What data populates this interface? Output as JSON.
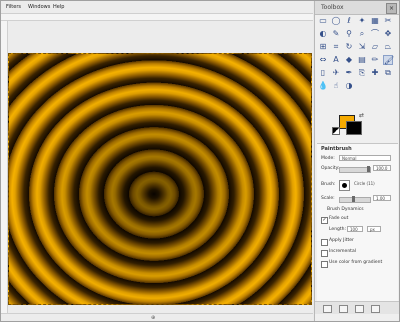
{
  "menubar": {
    "items": [
      "Filters",
      "Windows",
      "Help"
    ]
  },
  "toolbox": {
    "title": "Toolbox",
    "close_label": "×",
    "foreground_color": "#f5aa00",
    "background_color": "#000000",
    "options": {
      "title": "Paintbrush",
      "mode_label": "Mode:",
      "mode_value": "Normal",
      "opacity_label": "Opacity:",
      "opacity_value": "100.0",
      "brush_label": "Brush:",
      "brush_value": "Circle (11)",
      "scale_label": "Scale:",
      "scale_value": "1.00",
      "brush_dynamics_label": "Brush Dynamics",
      "fade_out_label": "Fade out",
      "length_label": "Length:",
      "length_value": "100",
      "length_unit": "px",
      "apply_jitter_label": "Apply Jitter",
      "incremental_label": "Incremental",
      "gradient_label": "Use color from gradient",
      "fade_out_checked": true,
      "apply_jitter_checked": false,
      "incremental_checked": false,
      "gradient_checked": false
    }
  },
  "image": {
    "description": "orange swirl ripple image"
  },
  "tools": [
    "rect-select",
    "ellipse-select",
    "free-select",
    "fuzzy-select",
    "select-by-color",
    "scissors",
    "foreground-select",
    "paths",
    "color-picker",
    "zoom",
    "measure",
    "move",
    "align",
    "crop",
    "rotate",
    "scale",
    "shear",
    "perspective",
    "flip",
    "text",
    "bucket-fill",
    "blend",
    "pencil",
    "paintbrush",
    "eraser",
    "airbrush",
    "ink",
    "clone",
    "heal",
    "perspective-clone",
    "blur",
    "smudge",
    "dodge-burn"
  ]
}
